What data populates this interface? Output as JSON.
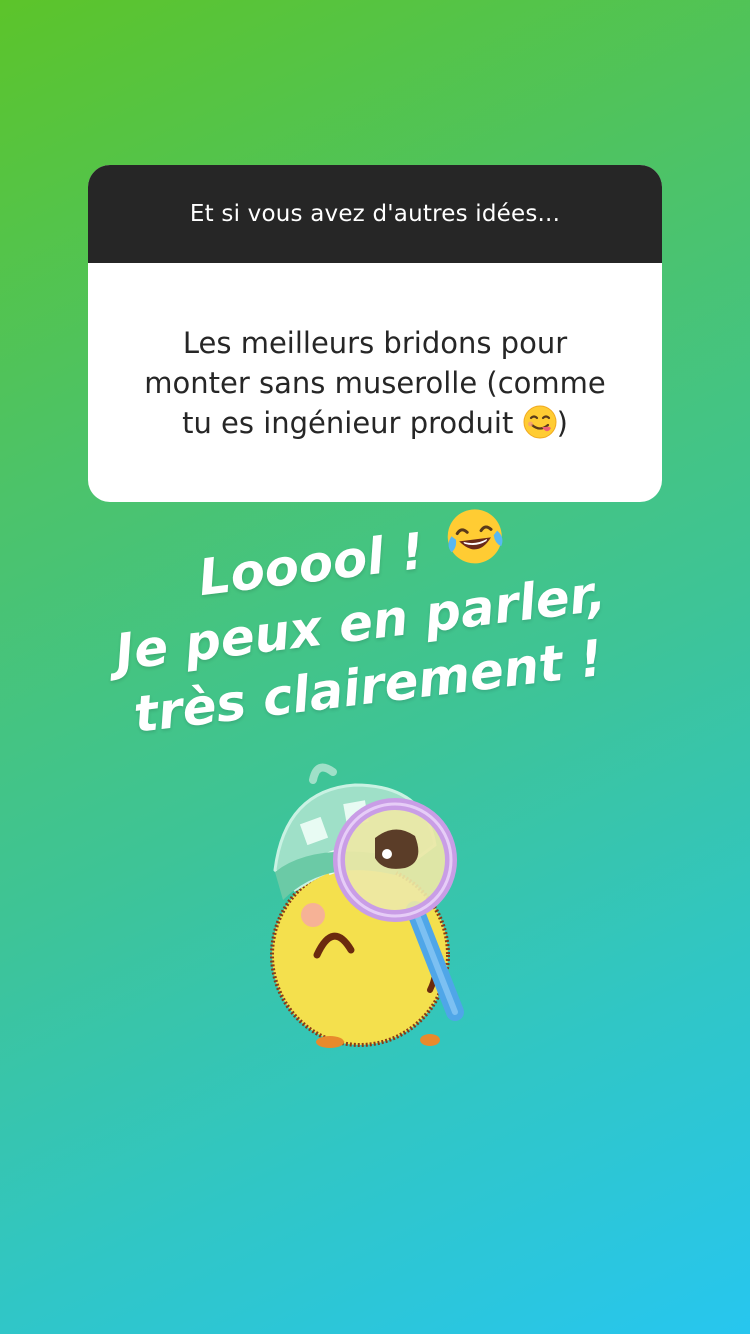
{
  "question_card": {
    "header": "Et si vous avez d'autres idées...",
    "answer_line1": "Les meilleurs bridons pour",
    "answer_line2": "monter sans muserolle (comme",
    "answer_line3_before": "tu es ingénieur produit",
    "answer_line3_after": ")",
    "answer_emoji": "yum-face-icon"
  },
  "overlay_text": {
    "line1": "Looool !",
    "line1_emoji": "laughing-tears-icon",
    "line2": "Je peux en parler,",
    "line3": "très clairement !"
  },
  "sticker": {
    "icon": "detective-chick-sticker"
  },
  "colors": {
    "gradient_start": "#5cc42a",
    "gradient_end": "#27c6ef",
    "card_header": "#262626",
    "card_body": "#ffffff"
  }
}
